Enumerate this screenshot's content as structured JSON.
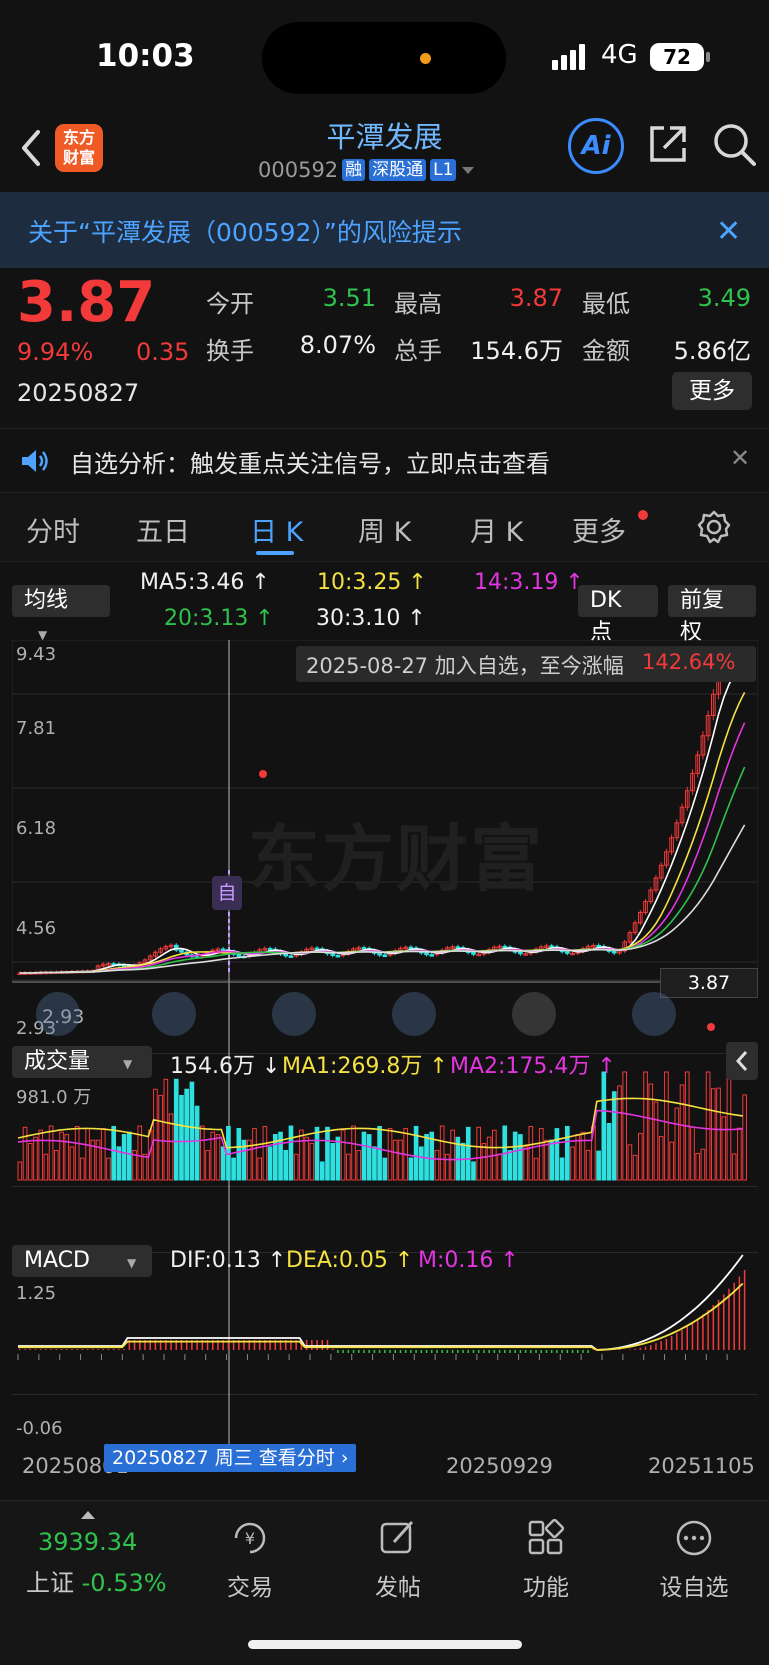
{
  "status": {
    "time": "10:03",
    "network": "4G",
    "battery": "72"
  },
  "header": {
    "logo_line1": "东方",
    "logo_line2": "财富",
    "title": "平潭发展",
    "code": "000592",
    "tags": [
      "融",
      "深股通",
      "L1"
    ],
    "ai_label": "Ai"
  },
  "risk": {
    "text": "关于“平潭发展（000592）”的风险提示",
    "close": "✕"
  },
  "quote": {
    "price": "3.87",
    "change_pct": "9.94%",
    "change": "0.35",
    "date": "20250827",
    "fields": [
      {
        "label": "今开",
        "value": "3.51",
        "color": "#2fc24c"
      },
      {
        "label": "最高",
        "value": "3.87",
        "color": "#f23a3a"
      },
      {
        "label": "最低",
        "value": "3.49",
        "color": "#2fc24c"
      },
      {
        "label": "换手",
        "value": "8.07%",
        "color": "#e6e6e6"
      },
      {
        "label": "总手",
        "value": "154.6万",
        "color": "#e6e6e6"
      },
      {
        "label": "金额",
        "value": "5.86亿",
        "color": "#e6e6e6"
      }
    ],
    "more": "更多"
  },
  "analysis": {
    "text": "自选分析：触发重点关注信号，立即点击查看",
    "close": "✕"
  },
  "tabs": [
    {
      "label": "分时"
    },
    {
      "label": "五日"
    },
    {
      "label": "日 K"
    },
    {
      "label": "周 K"
    },
    {
      "label": "月 K"
    },
    {
      "label": "更多"
    }
  ],
  "ma_row": {
    "selector": "均线",
    "ma5": "MA5:3.46 ↑",
    "ma10": "10:3.25 ↑",
    "ma14": "14:3.19 ↑",
    "ma20": "20:3.13 ↑",
    "ma30": "30:3.10 ↑",
    "dk": "DK 点",
    "adjust": "前复权"
  },
  "kline": {
    "y_ticks": [
      "9.43",
      "7.81",
      "6.18",
      "4.56",
      "2.93"
    ],
    "low_label": "2.93",
    "hint": "2025-08-27 加入自选，至今涨幅",
    "hint_pct": "142.64%",
    "price_tag": "3.87",
    "marker": "自",
    "watermark": "东方财富"
  },
  "volume": {
    "selector": "成交量",
    "value": "154.6万 ↓",
    "ma1": "MA1:269.8万 ↑",
    "ma2": "MA2:175.4万 ↑",
    "y_top": "981.0 万"
  },
  "macd": {
    "selector": "MACD",
    "dif": "DIF:0.13 ↑",
    "dea": "DEA:0.05 ↑",
    "m": "M:0.16 ↑",
    "y_top": "1.25",
    "y_bottom": "-0.06",
    "x_labels": [
      "20250801",
      "20250929",
      "20251105"
    ],
    "cursor_label": "20250827 周三 查看分时"
  },
  "bottom_nav": {
    "index_value": "3939.34",
    "index_name": "上证",
    "index_pct": "-0.53%",
    "items": [
      {
        "label": "交易"
      },
      {
        "label": "发帖"
      },
      {
        "label": "功能"
      },
      {
        "label": "设自选"
      }
    ]
  },
  "colors": {
    "up": "#f23a3a",
    "down": "#2fc24c",
    "accent": "#4da3ff",
    "ma5": "#ffffff",
    "ma10": "#f5e141",
    "ma14": "#e335e0",
    "ma20": "#2fc24c",
    "vol_down": "#2fe0e0"
  }
}
